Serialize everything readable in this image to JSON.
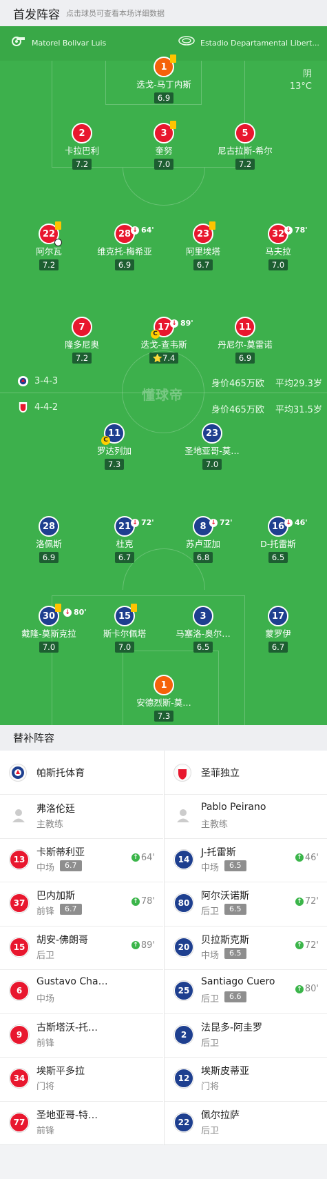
{
  "header": {
    "title": "首发阵容",
    "subtitle": "点击球员可查看本场详细数据"
  },
  "venue": {
    "referee": "Matorel Bolivar Luis",
    "stadium": "Estadio Departamental Libert..."
  },
  "weather": {
    "condition": "阴",
    "temp": "13°C"
  },
  "watermark": "懂球帝",
  "home": {
    "formation": "3-4-3",
    "value": "身价465万欧",
    "age": "平均29.3岁",
    "players": [
      {
        "num": "1",
        "name": "迭戈-马丁内斯",
        "rating": "6.9",
        "yellow": true
      },
      {
        "num": "2",
        "name": "卡拉巴利",
        "rating": "7.2"
      },
      {
        "num": "3",
        "name": "奎努",
        "rating": "7.0",
        "yellow": true
      },
      {
        "num": "5",
        "name": "尼古拉斯-希尔",
        "rating": "7.2"
      },
      {
        "num": "22",
        "name": "阿尔瓦",
        "rating": "7.2",
        "yellow": true,
        "goal": true
      },
      {
        "num": "28",
        "name": "维克托-梅希亚",
        "rating": "6.9",
        "sub": "64'"
      },
      {
        "num": "23",
        "name": "阿里埃塔",
        "rating": "6.7",
        "yellow": true
      },
      {
        "num": "32",
        "name": "马夫拉",
        "rating": "7.0",
        "sub": "78'"
      },
      {
        "num": "7",
        "name": "隆多尼奥",
        "rating": "7.2"
      },
      {
        "num": "17",
        "name": "迭戈-查韦斯",
        "rating": "⭐7.4",
        "sub": "89'",
        "captain": true
      },
      {
        "num": "11",
        "name": "丹尼尔-莫雷诺",
        "rating": "6.9"
      }
    ]
  },
  "away": {
    "formation": "4-4-2",
    "value": "身价465万欧",
    "age": "平均31.5岁",
    "players": [
      {
        "num": "11",
        "name": "罗达列加",
        "rating": "7.3",
        "captain": true
      },
      {
        "num": "23",
        "name": "圣地亚哥-莫…",
        "rating": "7.0"
      },
      {
        "num": "28",
        "name": "洛佩斯",
        "rating": "6.9"
      },
      {
        "num": "21",
        "name": "杜克",
        "rating": "6.7",
        "sub": "72'"
      },
      {
        "num": "8",
        "name": "苏卢亚加",
        "rating": "6.8",
        "sub": "72'"
      },
      {
        "num": "16",
        "name": "D-托雷斯",
        "rating": "6.5",
        "sub": "46'"
      },
      {
        "num": "30",
        "name": "戴隆-莫斯克拉",
        "rating": "7.0",
        "yellow": true,
        "sub": "80'"
      },
      {
        "num": "15",
        "name": "斯卡尔佩塔",
        "rating": "7.0",
        "yellow": true
      },
      {
        "num": "3",
        "name": "马塞洛-奥尔…",
        "rating": "6.5"
      },
      {
        "num": "17",
        "name": "蒙罗伊",
        "rating": "6.7"
      },
      {
        "num": "1",
        "name": "安德烈斯-莫…",
        "rating": "7.3"
      }
    ]
  },
  "bench": {
    "title": "替补阵容",
    "left": {
      "team": "帕斯托体育",
      "coach": {
        "name": "弗洛伦廷",
        "role": "主教练"
      },
      "subs": [
        {
          "num": "13",
          "name": "卡斯蒂利亚",
          "pos": "中场",
          "rating": "6.7",
          "in": "64'"
        },
        {
          "num": "37",
          "name": "巴内加斯",
          "pos": "前锋",
          "rating": "6.7",
          "in": "78'"
        },
        {
          "num": "15",
          "name": "胡安-佛朗哥",
          "pos": "后卫",
          "rating": "",
          "in": "89'"
        },
        {
          "num": "6",
          "name": "Gustavo Cha…",
          "pos": "中场",
          "rating": "",
          "in": ""
        },
        {
          "num": "9",
          "name": "古斯塔沃-托…",
          "pos": "前锋",
          "rating": "",
          "in": ""
        },
        {
          "num": "34",
          "name": "埃斯平多拉",
          "pos": "门将",
          "rating": "",
          "in": ""
        },
        {
          "num": "77",
          "name": "圣地亚哥-特…",
          "pos": "前锋",
          "rating": "",
          "in": ""
        }
      ]
    },
    "right": {
      "team": "圣菲独立",
      "coach": {
        "name": "Pablo Peirano",
        "role": "主教练"
      },
      "subs": [
        {
          "num": "14",
          "name": "J-托雷斯",
          "pos": "中场",
          "rating": "6.5",
          "in": "46'"
        },
        {
          "num": "80",
          "name": "阿尔沃诺斯",
          "pos": "后卫",
          "rating": "6.5",
          "in": "72'"
        },
        {
          "num": "20",
          "name": "贝拉斯克斯",
          "pos": "中场",
          "rating": "6.5",
          "in": "72'"
        },
        {
          "num": "25",
          "name": "Santiago Cuero",
          "pos": "后卫",
          "rating": "6.6",
          "in": "80'"
        },
        {
          "num": "2",
          "name": "法昆多-阿圭罗",
          "pos": "后卫",
          "rating": "",
          "in": ""
        },
        {
          "num": "12",
          "name": "埃斯皮蒂亚",
          "pos": "门将",
          "rating": "",
          "in": ""
        },
        {
          "num": "22",
          "name": "佩尔拉萨",
          "pos": "后卫",
          "rating": "",
          "in": ""
        }
      ]
    }
  }
}
